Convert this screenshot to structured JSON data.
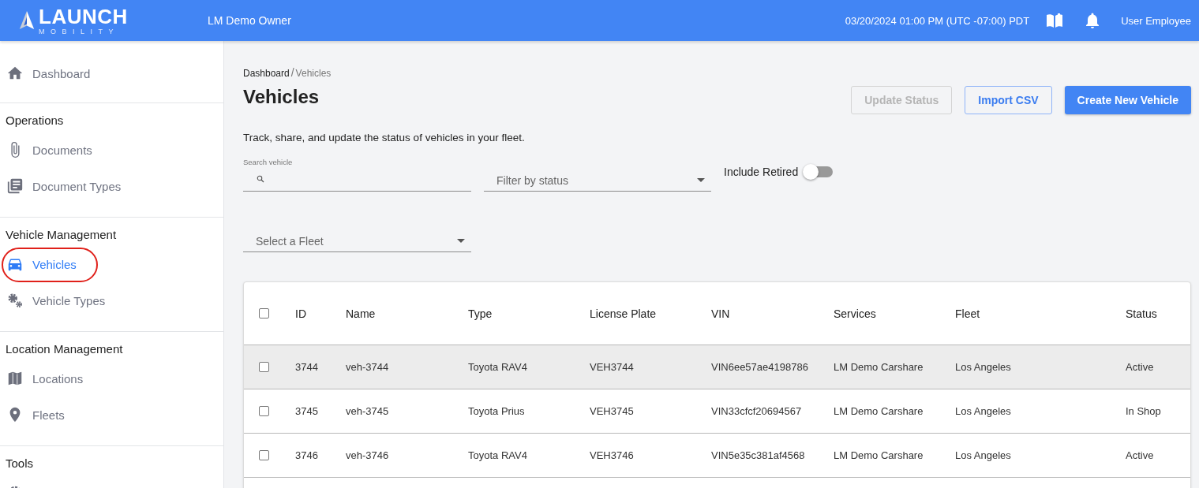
{
  "header": {
    "logo_word": "LAUNCH",
    "logo_sub": "MOBILITY",
    "organization": "LM Demo Owner",
    "datetime": "03/20/2024 01:00 PM (UTC -07:00) PDT",
    "user": "User Employee"
  },
  "sidebar": {
    "sections": [
      {
        "items": [
          {
            "label": "Dashboard",
            "selected": false,
            "circled": false
          }
        ]
      },
      {
        "title": "Operations",
        "items": [
          {
            "label": "Documents",
            "selected": false,
            "circled": false
          },
          {
            "label": "Document Types",
            "selected": false,
            "circled": false
          }
        ]
      },
      {
        "title": "Vehicle Management",
        "items": [
          {
            "label": "Vehicles",
            "selected": true,
            "circled": true
          },
          {
            "label": "Vehicle Types",
            "selected": false,
            "circled": false
          }
        ]
      },
      {
        "title": "Location Management",
        "items": [
          {
            "label": "Locations",
            "selected": false,
            "circled": false
          },
          {
            "label": "Fleets",
            "selected": false,
            "circled": false
          }
        ]
      },
      {
        "title": "Tools",
        "items": [
          {
            "selected": false,
            "circled": false
          }
        ]
      }
    ]
  },
  "breadcrumb": [
    {
      "label": "Dashboard",
      "current": false
    },
    {
      "label": "Vehicles",
      "current": true
    }
  ],
  "breadcrumb_separator": "/",
  "page_title": "Vehicles",
  "description": "Track, share, and update the status of vehicles in your fleet.",
  "buttons": [
    {
      "label": "Update Status",
      "kind": "outline",
      "disabled": true
    },
    {
      "label": "Import CSV",
      "kind": "outline",
      "disabled": false
    },
    {
      "label": "Create New Vehicle",
      "kind": "primary",
      "disabled": false
    }
  ],
  "search": {
    "label": "Search vehicle"
  },
  "status_filter": {
    "placeholder": "Filter by status"
  },
  "include_retired": {
    "label": "Include Retired",
    "on": false
  },
  "fleet_select": {
    "placeholder": "Select a Fleet"
  },
  "table": {
    "all_checked": false,
    "columns": [
      "ID",
      "Name",
      "Type",
      "License Plate",
      "VIN",
      "Services",
      "Fleet",
      "Status"
    ],
    "rows": [
      {
        "checked": false,
        "hovered": true,
        "cells": [
          "3744",
          "veh-3744",
          "Toyota RAV4",
          "VEH3744",
          "VIN6ee57ae4198786",
          "LM Demo Carshare",
          "Los Angeles",
          "Active"
        ]
      },
      {
        "checked": false,
        "hovered": false,
        "cells": [
          "3745",
          "veh-3745",
          "Toyota Prius",
          "VEH3745",
          "VIN33cfcf20694567",
          "LM Demo Carshare",
          "Los Angeles",
          "In Shop"
        ]
      },
      {
        "checked": false,
        "hovered": false,
        "cells": [
          "3746",
          "veh-3746",
          "Toyota RAV4",
          "VEH3746",
          "VIN5e35c381af4568",
          "LM Demo Carshare",
          "Los Angeles",
          "Active"
        ]
      }
    ]
  }
}
